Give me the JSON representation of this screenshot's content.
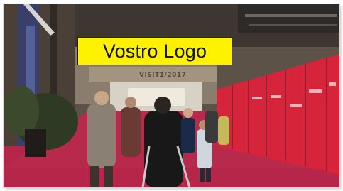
{
  "overlay": {
    "logo_text": "Vostro Logo"
  },
  "scene": {
    "sign_text": "VISIT1/2017"
  },
  "colors": {
    "logo_bg": "#fff200",
    "carpet": "#b5264a",
    "panels": "#d6243a"
  }
}
